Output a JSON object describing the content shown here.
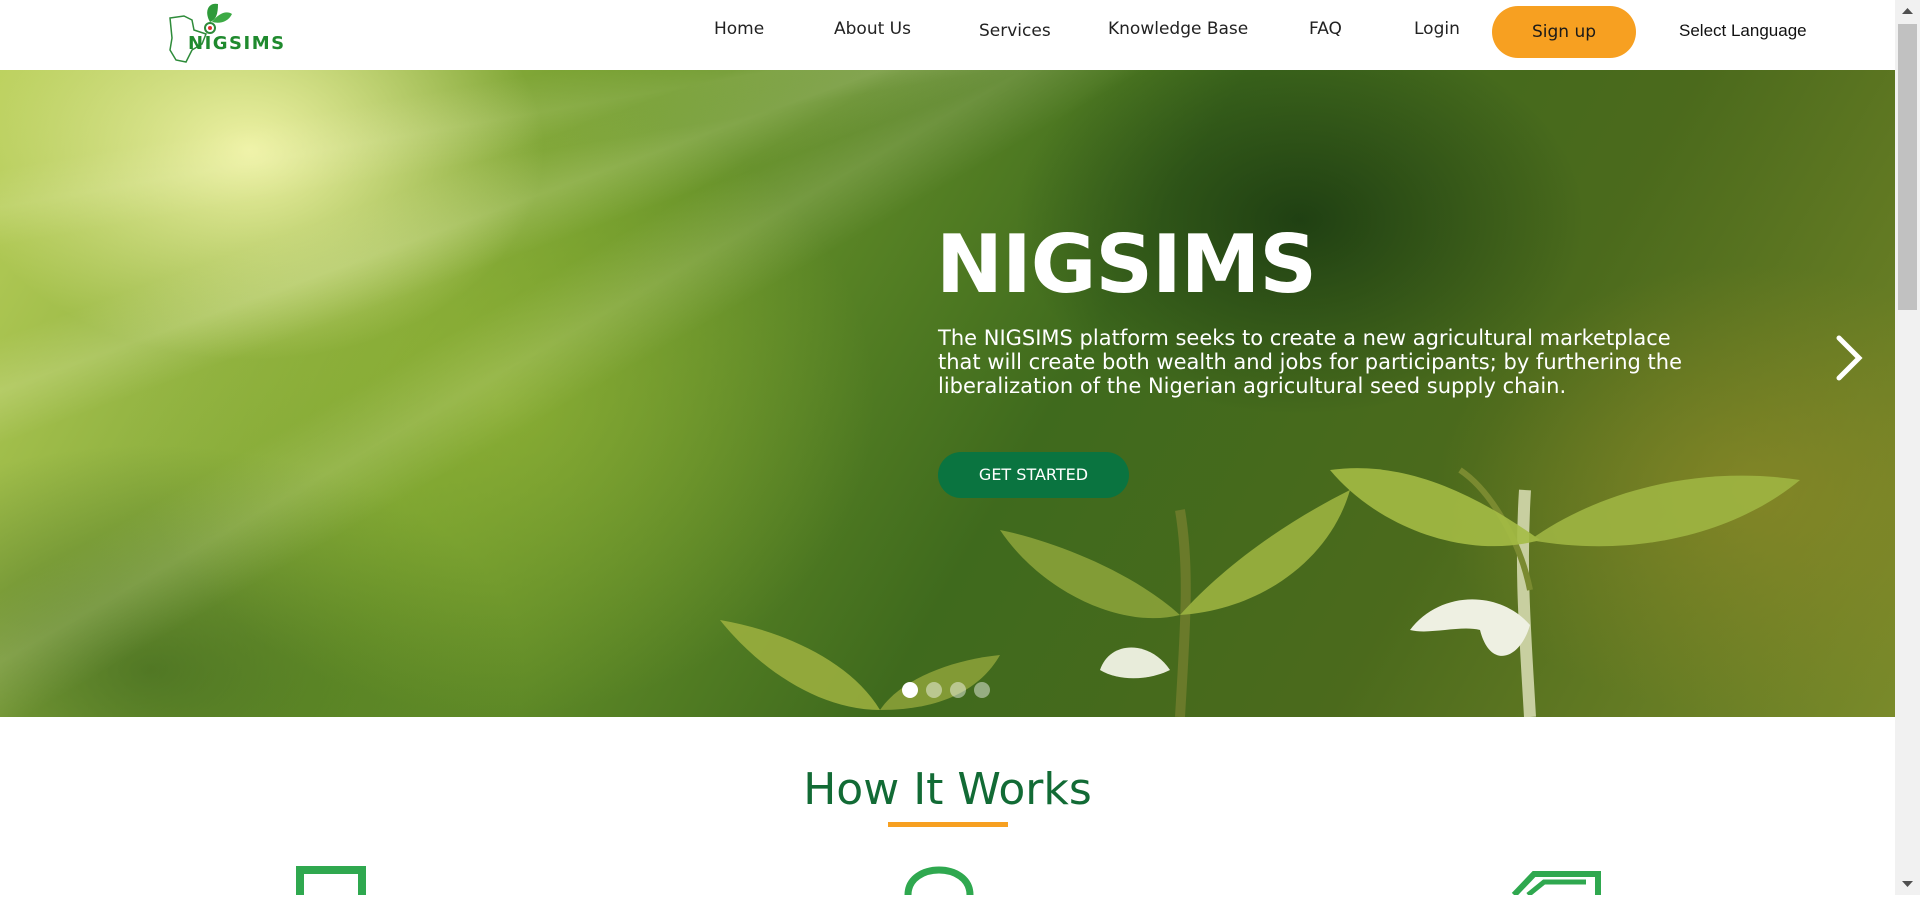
{
  "brand": {
    "logo_text": "NIGSIMS",
    "logo_icon": "leaf-nigeria-map-icon",
    "color": "#1f8a2e"
  },
  "nav": {
    "items": [
      {
        "label": "Home"
      },
      {
        "label": "About Us"
      },
      {
        "label": "Services"
      },
      {
        "label": "Knowledge Base"
      },
      {
        "label": "FAQ"
      },
      {
        "label": "Login"
      }
    ],
    "signup_label": "Sign up",
    "language_label": "Select Language"
  },
  "hero": {
    "title": "NIGSIMS",
    "description": "The NIGSIMS platform seeks to create a new agricultural marketplace that will create both wealth and jobs for participants; by furthering the liberalization of the Nigerian agricultural seed supply chain.",
    "cta_label": "GET STARTED",
    "next_icon": "chevron-right-icon",
    "slide_count": 4,
    "active_slide": 1
  },
  "how_it_works": {
    "title": "How It Works",
    "icons": [
      "tablet-icon",
      "search-icon",
      "card-icon"
    ]
  },
  "colors": {
    "accent_orange": "#f7a021",
    "brand_green": "#126b35",
    "cta_green": "#0a7440"
  }
}
